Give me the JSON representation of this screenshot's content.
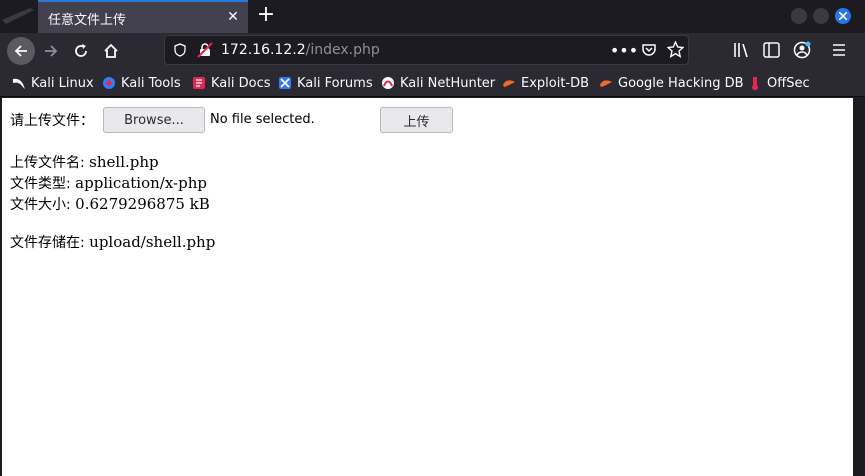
{
  "tab": {
    "title": "任意文件上传"
  },
  "url": {
    "host": "172.16.12.2",
    "path": "/index.php"
  },
  "bookmarks": [
    {
      "label": "Kali Linux"
    },
    {
      "label": "Kali Tools"
    },
    {
      "label": "Kali Docs"
    },
    {
      "label": "Kali Forums"
    },
    {
      "label": "Kali NetHunter"
    },
    {
      "label": "Exploit-DB"
    },
    {
      "label": "Google Hacking DB"
    },
    {
      "label": "OffSec"
    }
  ],
  "form": {
    "label": "请上传文件：",
    "browse_label": "Browse...",
    "file_status": "No file selected.",
    "submit_label": "上传"
  },
  "result": {
    "name_label": "上传文件名: ",
    "name_value": "shell.php",
    "type_label": "文件类型: ",
    "type_value": "application/x-php",
    "size_label": "文件大小: ",
    "size_value": "0.6279296875 kB",
    "stored_label": "文件存储在: ",
    "stored_value": "upload/shell.php"
  },
  "colors": {
    "tab_accent": "#2a7bd8",
    "chrome_bg": "#2b2a33",
    "page_bg": "#ffffff"
  }
}
